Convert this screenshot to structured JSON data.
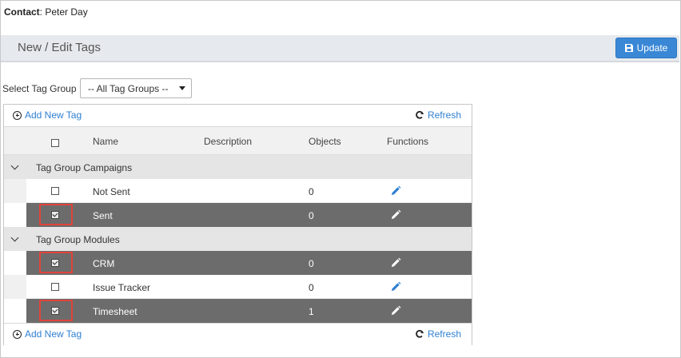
{
  "contact": {
    "label": "Contact",
    "value": "Peter Day"
  },
  "header": {
    "title": "New / Edit Tags",
    "update_label": "Update"
  },
  "filter": {
    "label": "Select Tag Group",
    "selected": "-- All Tag Groups --"
  },
  "toolbar": {
    "add_label": "Add New Tag",
    "refresh_label": "Refresh"
  },
  "columns": {
    "name": "Name",
    "description": "Description",
    "objects": "Objects",
    "functions": "Functions"
  },
  "groups": [
    {
      "name": "Tag Group Campaigns",
      "rows": [
        {
          "name": "Not Sent",
          "description": "",
          "objects": "0",
          "checked": false
        },
        {
          "name": "Sent",
          "description": "",
          "objects": "0",
          "checked": true
        }
      ]
    },
    {
      "name": "Tag Group Modules",
      "rows": [
        {
          "name": "CRM",
          "description": "",
          "objects": "0",
          "checked": true
        },
        {
          "name": "Issue Tracker",
          "description": "",
          "objects": "0",
          "checked": false
        },
        {
          "name": "Timesheet",
          "description": "",
          "objects": "1",
          "checked": true
        }
      ]
    }
  ],
  "colors": {
    "accent_blue": "#3a87d6",
    "link_blue": "#2f7fd1",
    "selected_row": "#6c6c6c",
    "highlight_red": "#e0443c"
  },
  "icons": {
    "update": "floppy-disk-icon",
    "add": "plus-circle-icon",
    "refresh": "refresh-icon",
    "edit": "pencil-icon",
    "group_toggle": "chevron-down-icon"
  }
}
